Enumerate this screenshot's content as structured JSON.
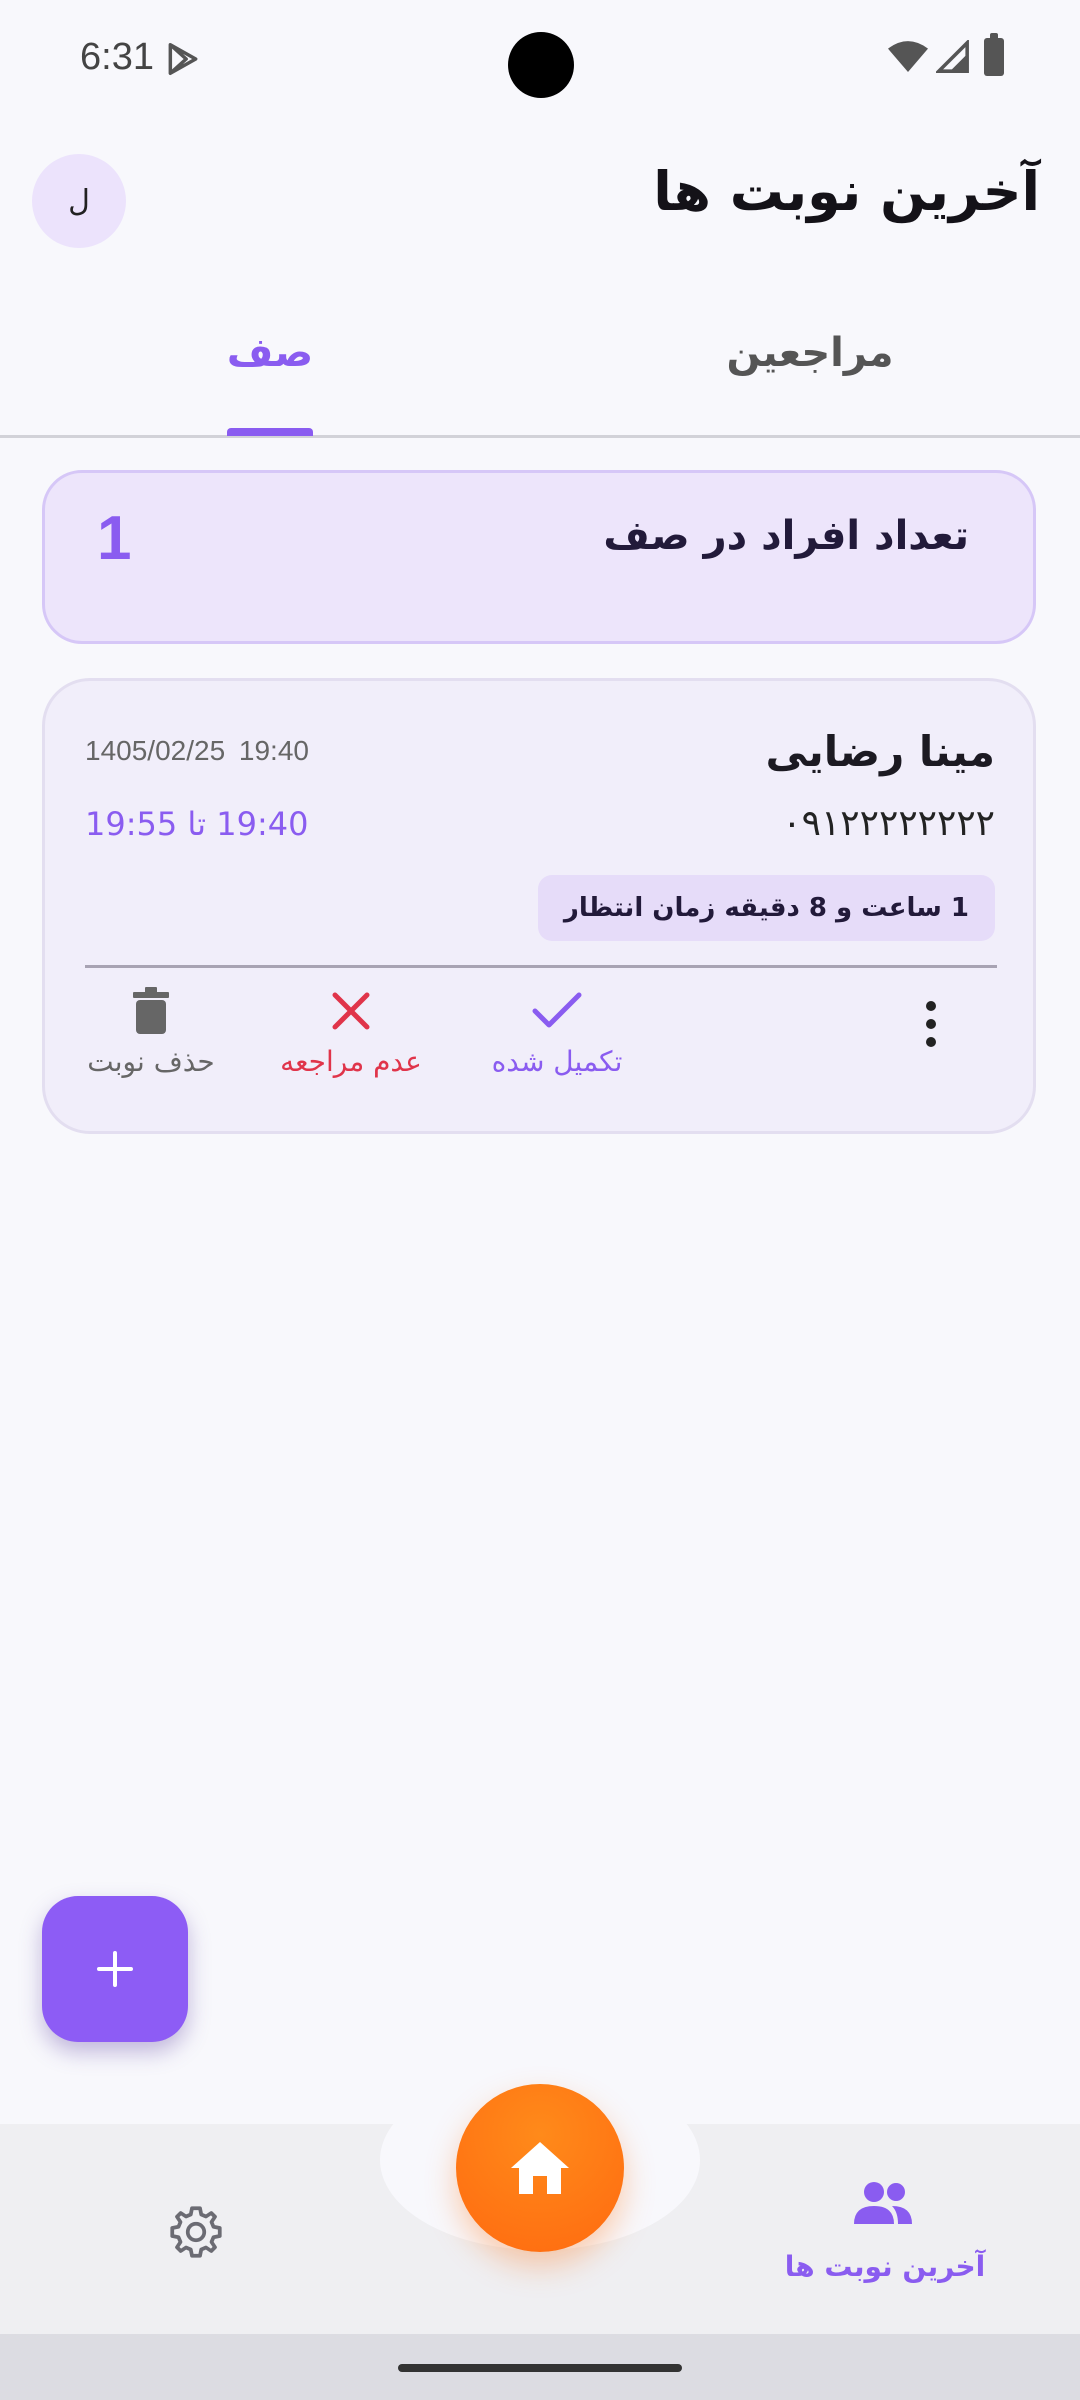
{
  "status_bar": {
    "time": "6:31"
  },
  "header": {
    "title": "آخرین نوبت ها",
    "avatar_letter": "ل"
  },
  "tabs": [
    {
      "label": "صف",
      "active": true
    },
    {
      "label": "مراجعین",
      "active": false
    }
  ],
  "queue_summary": {
    "label": "تعداد افراد در صف",
    "count": "1"
  },
  "appointment": {
    "name": "مینا رضایی",
    "phone": "۰۹۱۲۲۲۲۲۲۲۲",
    "datetime": "1405/02/25  19:40",
    "time_range": "19:40 تا 19:55",
    "wait_time": "1 ساعت و 8 دقیقه زمان انتظار",
    "actions": {
      "complete": "تکمیل شده",
      "no_show": "عدم مراجعه",
      "delete": "حذف نوبت"
    }
  },
  "bottom_nav": {
    "latest_label": "آخرین نوبت ها"
  },
  "colors": {
    "accent": "#8a5cf0",
    "danger": "#e0344a",
    "home": "#ff7a12"
  }
}
